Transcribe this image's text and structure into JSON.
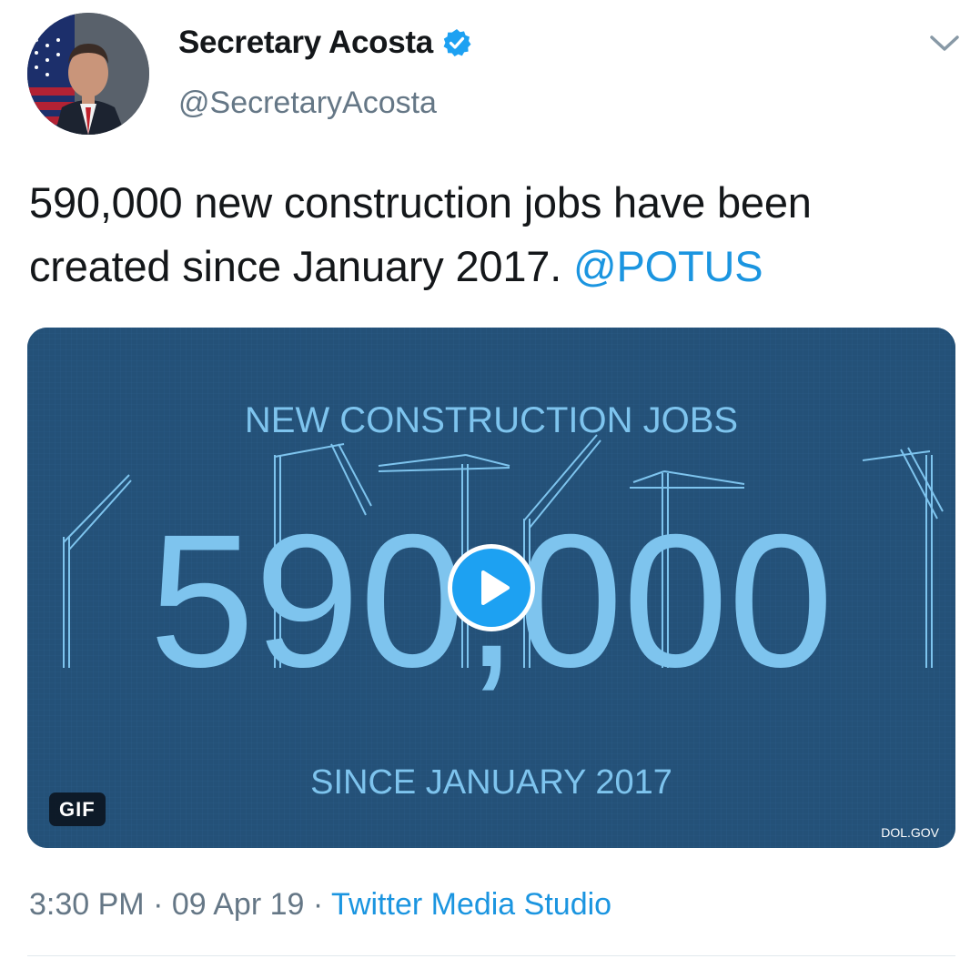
{
  "author": {
    "display_name": "Secretary Acosta",
    "handle": "@SecretaryAcosta",
    "verified": true
  },
  "tweet": {
    "text": "590,000 new construction jobs have been created since January 2017.",
    "mention": "@POTUS"
  },
  "media": {
    "type": "GIF",
    "badge": "GIF",
    "headline": "NEW CONSTRUCTION JOBS",
    "big_number": "590,000",
    "subline": "SINCE JANUARY 2017",
    "credit": "DOL.GOV"
  },
  "meta": {
    "time": "3:30 PM",
    "separator": "·",
    "date": "09 Apr 19",
    "source": "Twitter Media Studio"
  },
  "colors": {
    "link": "#1b95e0",
    "media_bg": "#245178",
    "media_text": "#7ec4ee",
    "play_button": "#1da1f2"
  },
  "icons": {
    "verified": "verified-badge-icon",
    "caret": "chevron-down-icon",
    "play": "play-icon"
  }
}
